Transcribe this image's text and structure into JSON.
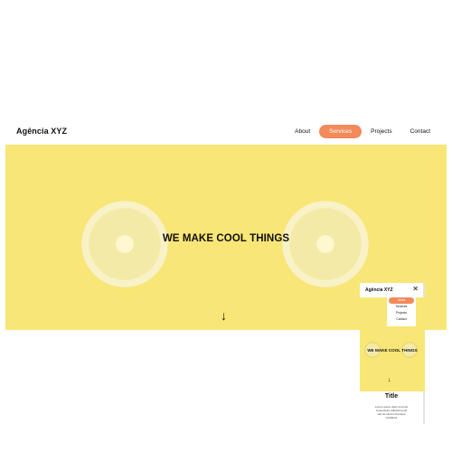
{
  "header": {
    "brand": "Agência XYZ",
    "nav": [
      "About",
      "Services",
      "Projects",
      "Contact"
    ],
    "active_nav": "Services"
  },
  "hero": {
    "headline": "WE MAKE COOL THINGS",
    "arrow": "↓"
  },
  "mobile": {
    "brand": "Agência XYZ",
    "close": "✕",
    "menu": [
      "About",
      "Services",
      "Projects",
      "Contact"
    ],
    "active_menu": "About",
    "headline": "WE MAKE COOL THINGS",
    "arrow": "↓",
    "section_title": "Title",
    "section_text": "Lorem ipsum dolor sit amet consectetur adipiscing elit sed do eiusmod tempor incididunt"
  },
  "colors": {
    "hero_bg": "#f8e676",
    "accent": "#f28a5a",
    "text": "#111111"
  }
}
